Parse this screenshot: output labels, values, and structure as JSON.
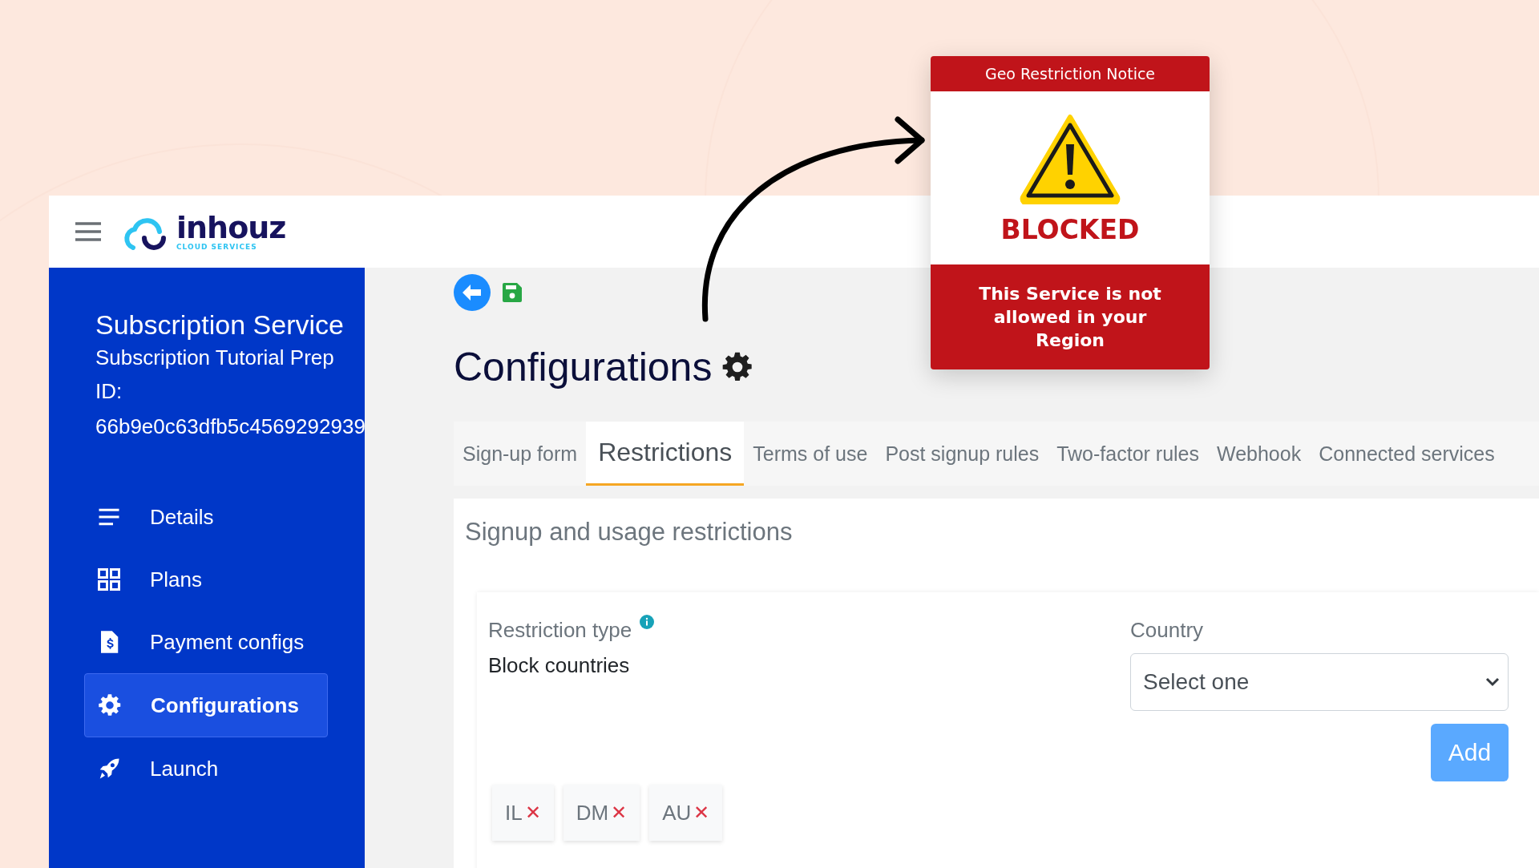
{
  "header": {
    "logo": {
      "name": "inhouz",
      "tagline": "CLOUD SERVICES"
    }
  },
  "sidebar": {
    "title": "Subscription Service",
    "subtitle": "Subscription Tutorial Prep",
    "id_label": "ID:",
    "id_value": "66b9e0c63dfb5c4569292939",
    "items": [
      {
        "label": "Details",
        "selected": false
      },
      {
        "label": "Plans",
        "selected": false
      },
      {
        "label": "Payment configs",
        "selected": false
      },
      {
        "label": "Configurations",
        "selected": true
      },
      {
        "label": "Launch",
        "selected": false
      }
    ]
  },
  "page": {
    "title": "Configurations"
  },
  "tabs": [
    {
      "label": "Sign-up form",
      "selected": false
    },
    {
      "label": "Restrictions",
      "selected": true
    },
    {
      "label": "Terms of use",
      "selected": false
    },
    {
      "label": "Post signup rules",
      "selected": false
    },
    {
      "label": "Two-factor rules",
      "selected": false
    },
    {
      "label": "Webhook",
      "selected": false
    },
    {
      "label": "Connected services",
      "selected": false
    }
  ],
  "section": {
    "title": "Signup and usage restrictions",
    "restriction_type_label": "Restriction type",
    "restriction_type_value": "Block countries",
    "country_label": "Country",
    "country_placeholder": "Select one",
    "add_button": "Add",
    "countries": [
      {
        "code": "IL",
        "remove": "✕"
      },
      {
        "code": "DM",
        "remove": "✕"
      },
      {
        "code": "AU",
        "remove": "✕"
      }
    ]
  },
  "notice": {
    "title": "Geo Restriction Notice",
    "status": "BLOCKED",
    "message": "This Service is not allowed in your Region"
  }
}
